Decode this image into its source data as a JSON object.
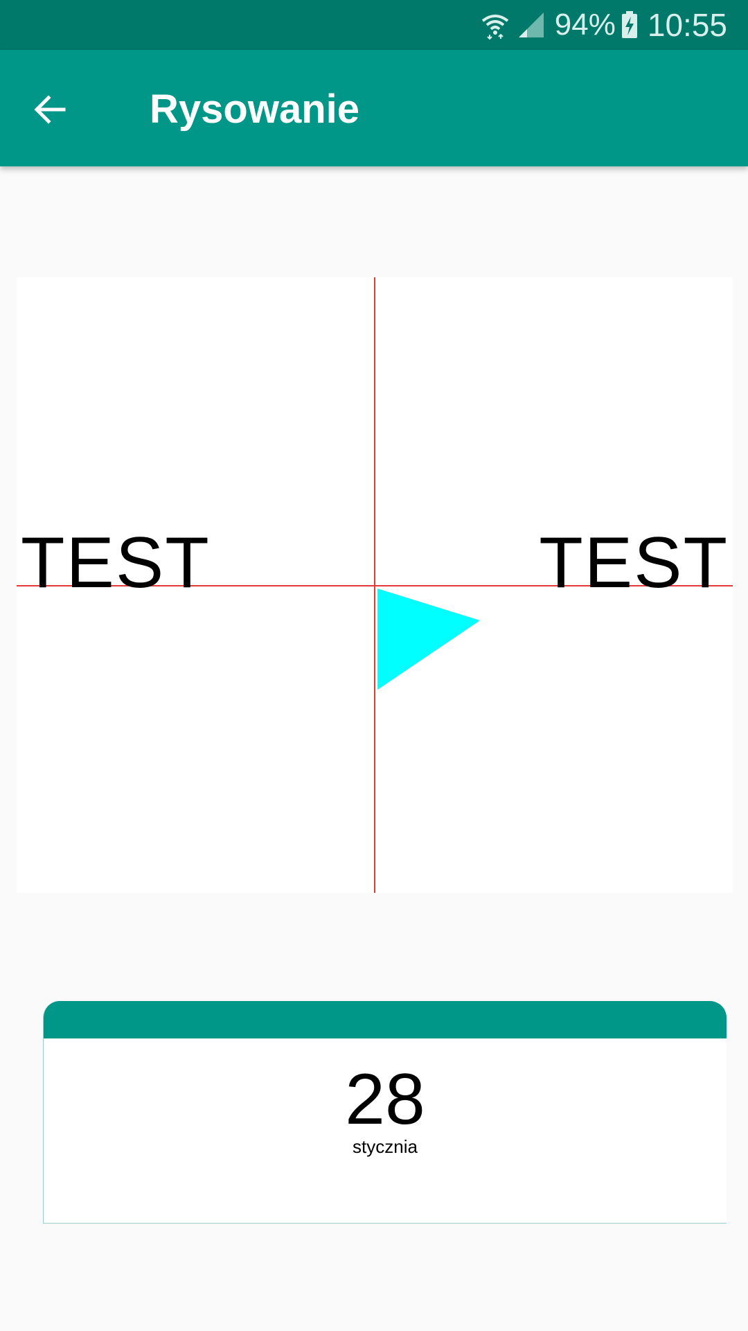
{
  "status_bar": {
    "battery": "94%",
    "time": "10:55",
    "icons": [
      "wifi-icon",
      "signal-icon",
      "battery-charging-icon"
    ]
  },
  "app_bar": {
    "title": "Rysowanie",
    "back_icon": "arrow-back-icon"
  },
  "canvas": {
    "text_left": "TEST",
    "text_right": "TEST",
    "axis_color": "#e53935",
    "triangle_color": "#00ffff"
  },
  "calendar": {
    "day": "28",
    "month": "stycznia",
    "header_color": "#009688"
  },
  "colors": {
    "status_bar": "#00796b",
    "app_bar": "#009688",
    "background": "#fafafa"
  }
}
